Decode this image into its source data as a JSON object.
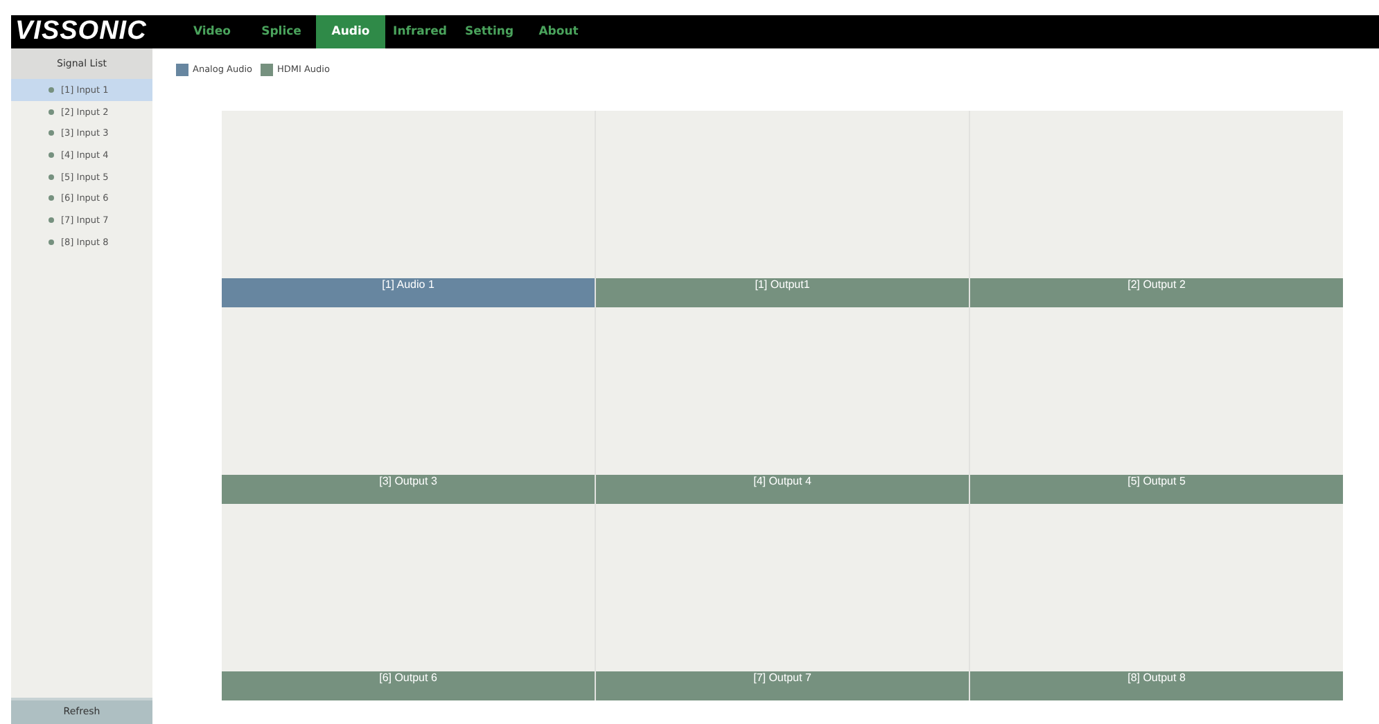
{
  "logo": "VISSONIC",
  "tabs": [
    {
      "label": "Video",
      "selected": false
    },
    {
      "label": "Splice",
      "selected": false
    },
    {
      "label": "Audio",
      "selected": true
    },
    {
      "label": "Infrared",
      "selected": false
    },
    {
      "label": "Setting",
      "selected": false
    },
    {
      "label": "About",
      "selected": false
    }
  ],
  "sidebar": {
    "title": "Signal List",
    "items": [
      {
        "label": "[1] Input 1",
        "selected": true
      },
      {
        "label": "[2] Input 2",
        "selected": false
      },
      {
        "label": "[3] Input 3",
        "selected": false
      },
      {
        "label": "[4] Input 4",
        "selected": false
      },
      {
        "label": "[5] Input 5",
        "selected": false
      },
      {
        "label": "[6] Input 6",
        "selected": false
      },
      {
        "label": "[7] Input 7",
        "selected": false
      },
      {
        "label": "[8] Input 8",
        "selected": false
      }
    ],
    "button": "Refresh"
  },
  "legend": [
    {
      "label": "Analog Audio",
      "color": "#6786a0"
    },
    {
      "label": "HDMI Audio",
      "color": "#76917f"
    }
  ],
  "tiles": [
    {
      "label": "[1] Audio 1",
      "kind": "analog"
    },
    {
      "label": "[1] Output1",
      "kind": "hdmi"
    },
    {
      "label": "[2] Output 2",
      "kind": "hdmi"
    },
    {
      "label": "[3] Output 3",
      "kind": "hdmi"
    },
    {
      "label": "[4] Output 4",
      "kind": "hdmi"
    },
    {
      "label": "[5] Output 5",
      "kind": "hdmi"
    },
    {
      "label": "[6] Output 6",
      "kind": "hdmi"
    },
    {
      "label": "[7] Output 7",
      "kind": "hdmi"
    },
    {
      "label": "[8] Output 8",
      "kind": "hdmi"
    }
  ]
}
